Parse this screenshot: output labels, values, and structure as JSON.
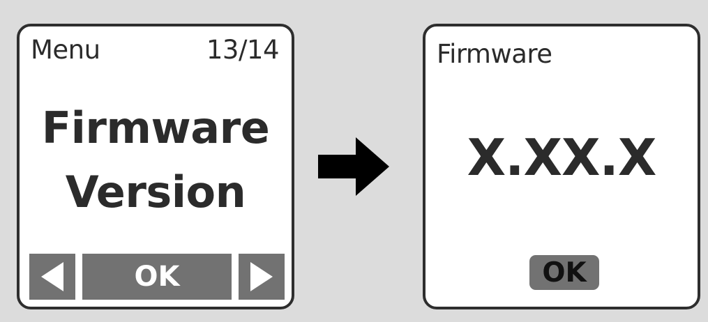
{
  "menu_screen": {
    "title": "Menu",
    "counter": "13/14",
    "item_line1": "Firmware",
    "item_line2": "Version",
    "softkeys": {
      "left_icon": "triangle-left-icon",
      "ok_label": "OK",
      "right_icon": "triangle-right-icon"
    }
  },
  "transition_icon": "arrow-right-icon",
  "firmware_screen": {
    "title": "Firmware",
    "version": "X.XX.X",
    "ok_label": "OK"
  },
  "colors": {
    "background": "#dcdcdc",
    "screen_fill": "#ffffff",
    "screen_border": "#2e2e2e",
    "softkey_fill": "#727272",
    "text": "#2b2b2b",
    "arrow": "#000000"
  }
}
